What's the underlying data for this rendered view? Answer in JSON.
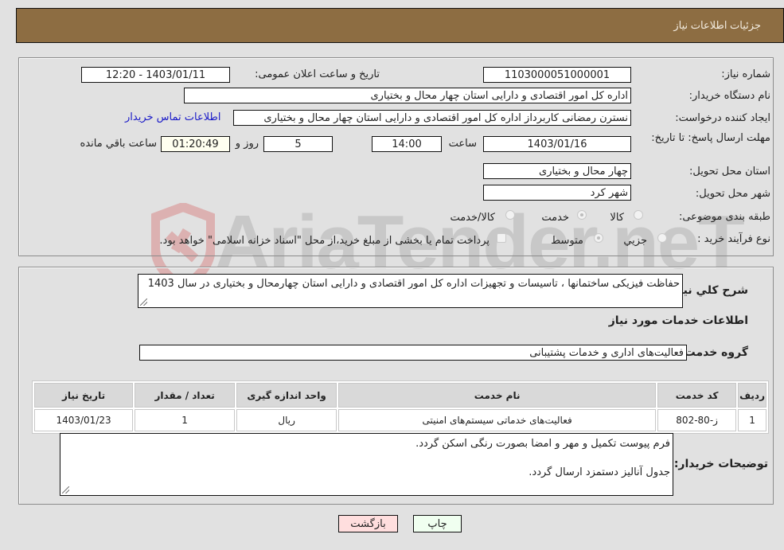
{
  "header": {
    "title": "جزئیات اطلاعات نیاز"
  },
  "fields": {
    "need_number_label": "شماره نیاز:",
    "need_number": "1103000051000001",
    "announce_label": "تاریخ و ساعت اعلان عمومی:",
    "announce_value": "1403/01/11 - 12:20",
    "buyer_org_label": "نام دستگاه خریدار:",
    "buyer_org": "اداره کل امور اقتصادی و دارایی استان چهار محال و بختیاری",
    "creator_label": "ایجاد کننده درخواست:",
    "creator": "نسترن رمضانی کاربرداز اداره کل امور اقتصادی و دارایی استان چهار محال و بختیاری",
    "contact_link": "اطلاعات تماس خریدار",
    "deadline_label": "مهلت ارسال پاسخ: تا تاریخ:",
    "deadline_date": "1403/01/16",
    "time_label": "ساعت",
    "deadline_time": "14:00",
    "days_value": "5",
    "days_label": "روز و",
    "remaining_time": "01:20:49",
    "remaining_label": "ساعت باقي مانده",
    "province_label": "استان محل تحویل:",
    "province": "چهار محال و بختیاری",
    "city_label": "شهر محل تحویل:",
    "city": "شهر کرد",
    "category_label": "طبقه بندی موضوعی:",
    "category_options": [
      {
        "label": "کالا",
        "checked": false
      },
      {
        "label": "خدمت",
        "checked": true
      },
      {
        "label": "کالا/خدمت",
        "checked": false
      }
    ],
    "process_label": "نوع فرآیند خرید :",
    "process_options": [
      {
        "label": "جزیي",
        "checked": false
      },
      {
        "label": "متوسط",
        "checked": true
      }
    ],
    "payment_note": "پرداخت تمام یا بخشی از مبلغ خرید،از محل \"اسناد خزانه اسلامی\" خواهد بود.",
    "payment_checked": false
  },
  "description": {
    "label": "شرح کلي نياز:",
    "text": "حفاظت فیزیکی ساختمانها ، تاسیسات و تجهیزات اداره کل امور اقتصادی و دارایی استان چهارمحال و بختیاری در سال 1403"
  },
  "services": {
    "section_title": "اطلاعات خدمات مورد نیاز",
    "group_label": "گروه خدمت:",
    "group_value": "فعالیت‌های اداری و خدمات پشتیبانی",
    "columns": [
      "ردیف",
      "کد خدمت",
      "نام خدمت",
      "واحد اندازه گیری",
      "تعداد / مقدار",
      "تاریخ نیاز"
    ],
    "rows": [
      [
        "1",
        "ز-80-802",
        "فعالیت‌های خدماتی سیستم‌های امنیتی",
        "ریال",
        "1",
        "1403/01/23"
      ]
    ]
  },
  "buyer_notes": {
    "label": "توضیحات خریدار:",
    "line1": "فرم پیوست تکمیل و مهر و امضا بصورت رنگی اسکن گردد.",
    "line2": "جدول آنالیز دستمزد ارسال گردد."
  },
  "buttons": {
    "print": "چاپ",
    "back": "بازگشت"
  },
  "watermark": {
    "text": "AriaTender.neT"
  },
  "colors": {
    "header_bg": "#8d6d42",
    "link": "#1a1ac8",
    "back_button_bg": "#ffdede",
    "print_button_bg": "#f0fff0"
  }
}
